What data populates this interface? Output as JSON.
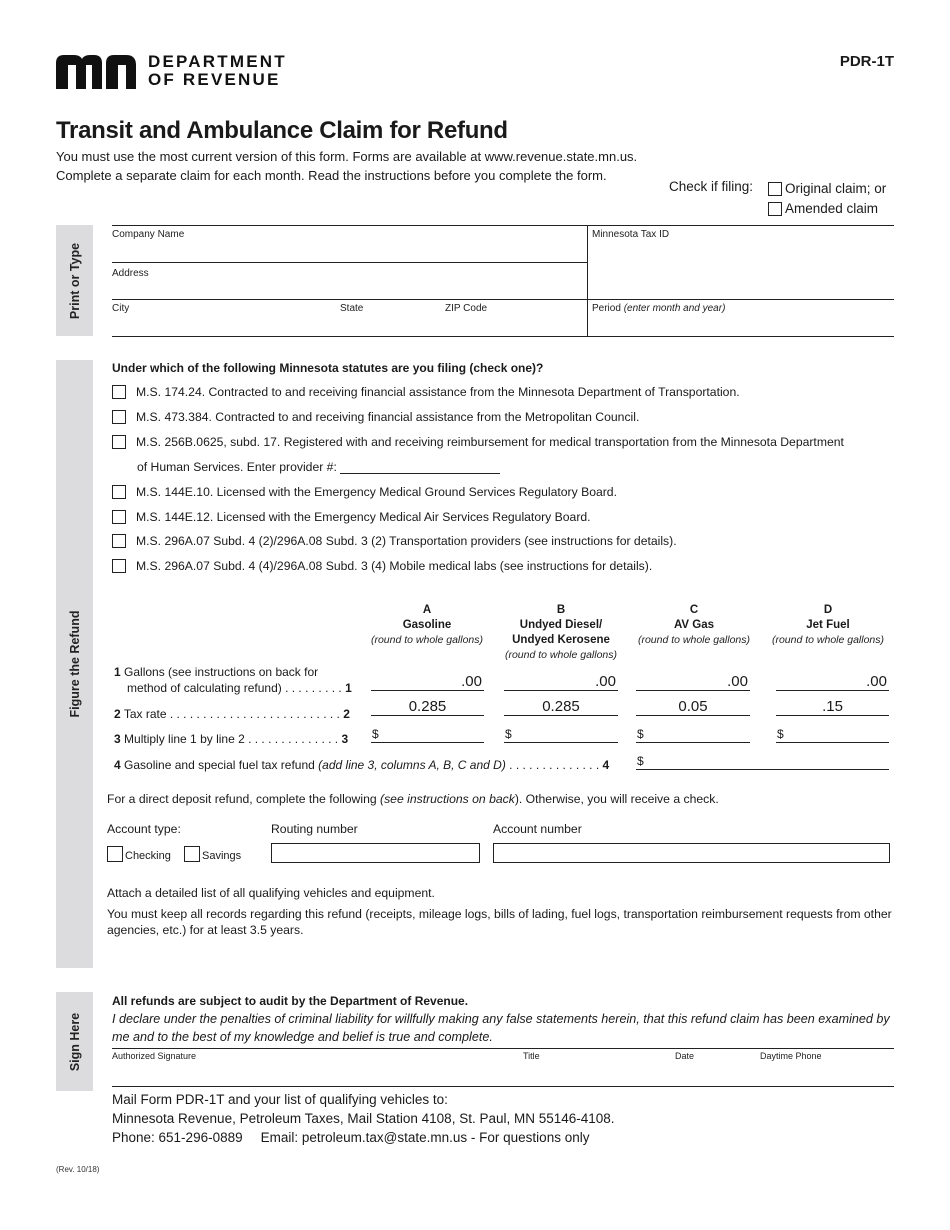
{
  "header": {
    "logo_icon": "mn-logo-icon",
    "agency_line1": "DEPARTMENT",
    "agency_line2": "OF REVENUE",
    "form_code": "PDR-1T",
    "title": "Transit and Ambulance Claim for Refund",
    "intro_line1": "You must use the most current version of this form. Forms are available at www.revenue.state.mn.us.",
    "intro_line2": "Complete a separate claim for each month. Read the instructions before you complete the form.",
    "check_if_filing": "Check if filing:",
    "filing_options": [
      {
        "label": "Original claim; or",
        "checked": false
      },
      {
        "label": "Amended claim",
        "checked": false
      }
    ]
  },
  "print_section": {
    "tab_label": "Print or Type",
    "company_name": "Company Name",
    "address": "Address",
    "city": "City",
    "state": "State",
    "zip": "ZIP Code",
    "tax_id": "Minnesota Tax ID",
    "period": "Period",
    "period_hint": "(enter month and year)"
  },
  "refund_section": {
    "tab_label": "Figure the Refund",
    "question": "Under which of the following Minnesota statutes are you filing (check one)?",
    "statutes": [
      {
        "label": "M.S. 174.24. Contracted to and receiving financial assistance from the Minnesota Department of Transportation.",
        "checked": false
      },
      {
        "label": "M.S. 473.384. Contracted to and receiving financial assistance from the Metropolitan Council.",
        "checked": false
      },
      {
        "label": "M.S. 256B.0625, subd. 17. Registered with and receiving reimbursement for medical transportation from the Minnesota Department",
        "checked": false
      },
      {
        "label": "M.S. 144E.10. Licensed with the Emergency Medical Ground Services Regulatory Board.",
        "checked": false
      },
      {
        "label": "M.S. 144E.12. Licensed with the Emergency Medical Air Services Regulatory Board.",
        "checked": false
      },
      {
        "label": "M.S. 296A.07 Subd. 4 (2)/296A.08 Subd. 3 (2) Transportation providers (see instructions for details).",
        "checked": false
      },
      {
        "label": "M.S. 296A.07 Subd. 4 (4)/296A.08 Subd. 3 (4) Mobile medical labs (see instructions for details).",
        "checked": false
      }
    ],
    "statute_3_cont": "of Human Services.  Enter provider #:",
    "provider_number": "",
    "columns": [
      {
        "letter": "A",
        "name": "Gasoline",
        "name2": "",
        "hint": "(round to whole gallons)",
        "gallons": ".00",
        "rate": "0.285",
        "amount": "$"
      },
      {
        "letter": "B",
        "name": "Undyed Diesel/",
        "name2": "Undyed Kerosene",
        "hint": "(round to whole gallons)",
        "gallons": ".00",
        "rate": "0.285",
        "amount": "$"
      },
      {
        "letter": "C",
        "name": "AV Gas",
        "name2": "",
        "hint": "(round to whole gallons)",
        "gallons": ".00",
        "rate": "0.05",
        "amount": "$"
      },
      {
        "letter": "D",
        "name": "Jet Fuel",
        "name2": "",
        "hint": "(round to whole gallons)",
        "gallons": ".00",
        "rate": ".15",
        "amount": "$"
      }
    ],
    "line1_num": "1",
    "line1_a": "Gallons (see instructions on back for",
    "line1_b": "method of calculating refund) . . . . . . . . .",
    "line2_num": "2",
    "line2": "Tax rate . . . . . . . . . . . . . . . . . . . . . . . . . .",
    "line3_num": "3",
    "line3": "Multiply line 1 by line 2 . . . . . . . . . . . . . .",
    "line4_num": "4",
    "line4": "Gasoline and special fuel tax refund",
    "line4_hint": "(add line 3, columns A, B, C and D)",
    "line4_dots": ". . . . . . . . . . . . . .",
    "line4_amount": "$",
    "deposit_a": "For a direct deposit refund, complete the following ",
    "deposit_hint": "(see instructions on back",
    "deposit_b": "). Otherwise, you will receive a check.",
    "account_type": "Account type:",
    "checking": "Checking",
    "savings": "Savings",
    "routing_number": "Routing number",
    "account_number": "Account number",
    "routing_value": "",
    "account_value": "",
    "attach_note": "Attach a detailed list of all qualifying vehicles and equipment.",
    "records_note": "You must keep all records regarding this refund (receipts, mileage logs, bills of lading, fuel logs, transportation reimbursement requests from other agencies, etc.) for at least 3.5 years."
  },
  "sign_section": {
    "tab_label": "Sign Here",
    "audit": "All refunds are subject to audit by the Department of Revenue.",
    "declaration": "I declare under the penalties of criminal liability for willfully making any false statements herein, that this refund claim has been examined by me and to the best of my knowledge and belief is true and complete.",
    "signature": "Authorized Signature",
    "title": "Title",
    "date": "Date",
    "phone": "Daytime Phone"
  },
  "footer": {
    "mail_line1": "Mail Form PDR-1T and your list of qualifying vehicles to:",
    "mail_line2": "Minnesota Revenue, Petroleum Taxes, Mail Station 4108, St. Paul, MN 55146-4108.",
    "phone": "Phone: 651-296-0889",
    "email": "Email: petroleum.tax@state.mn.us - For questions only",
    "revision": "(Rev. 10/18)"
  }
}
